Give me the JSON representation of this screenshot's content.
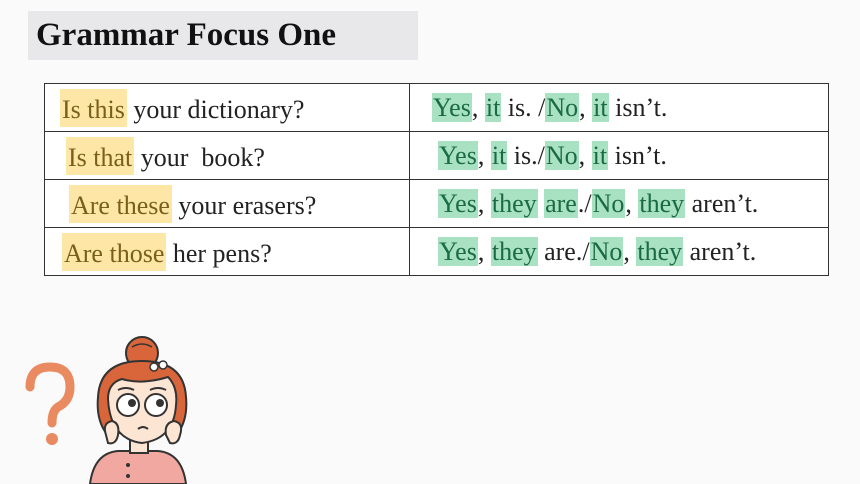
{
  "title": "Grammar Focus One",
  "rows": [
    {
      "question": [
        {
          "text": "Is this",
          "hl": "yellow"
        },
        {
          "text": " your dictionary?",
          "hl": ""
        }
      ],
      "answer": [
        {
          "text": "Yes",
          "hl": "green"
        },
        {
          "text": ", ",
          "hl": ""
        },
        {
          "text": "it",
          "hl": "green"
        },
        {
          "text": " is. /",
          "hl": ""
        },
        {
          "text": "No",
          "hl": "green"
        },
        {
          "text": ", ",
          "hl": ""
        },
        {
          "text": "it",
          "hl": "green"
        },
        {
          "text": " isn’t.",
          "hl": ""
        }
      ]
    },
    {
      "question": [
        {
          "text": "Is that",
          "hl": "yellow"
        },
        {
          "text": " your  book?",
          "hl": ""
        }
      ],
      "answer": [
        {
          "text": "Yes",
          "hl": "green"
        },
        {
          "text": ", ",
          "hl": ""
        },
        {
          "text": "it",
          "hl": "green"
        },
        {
          "text": " is./",
          "hl": ""
        },
        {
          "text": "No",
          "hl": "green"
        },
        {
          "text": ", ",
          "hl": ""
        },
        {
          "text": "it",
          "hl": "green"
        },
        {
          "text": " isn’t.",
          "hl": ""
        }
      ]
    },
    {
      "question": [
        {
          "text": "Are these",
          "hl": "yellow"
        },
        {
          "text": " your erasers?",
          "hl": ""
        }
      ],
      "answer": [
        {
          "text": "Yes",
          "hl": "green"
        },
        {
          "text": ", ",
          "hl": ""
        },
        {
          "text": "they",
          "hl": "green"
        },
        {
          "text": " ",
          "hl": ""
        },
        {
          "text": "are",
          "hl": "green"
        },
        {
          "text": "./",
          "hl": ""
        },
        {
          "text": "No",
          "hl": "green"
        },
        {
          "text": ", ",
          "hl": ""
        },
        {
          "text": "they",
          "hl": "green"
        },
        {
          "text": " aren’t.",
          "hl": ""
        }
      ]
    },
    {
      "question": [
        {
          "text": "Are those",
          "hl": "yellow"
        },
        {
          "text": " her pens?",
          "hl": ""
        }
      ],
      "answer": [
        {
          "text": "Yes",
          "hl": "green"
        },
        {
          "text": ", ",
          "hl": ""
        },
        {
          "text": "they",
          "hl": "green"
        },
        {
          "text": " are./",
          "hl": ""
        },
        {
          "text": "No",
          "hl": "green"
        },
        {
          "text": ", ",
          "hl": ""
        },
        {
          "text": "they",
          "hl": "green"
        },
        {
          "text": " aren’t.",
          "hl": ""
        }
      ]
    }
  ],
  "colors": {
    "highlight_question": "#fde6a6",
    "highlight_answer": "#a8e2c3",
    "question_mark": "#e98a60"
  },
  "illustration": {
    "icon": "thinking-girl-icon"
  }
}
